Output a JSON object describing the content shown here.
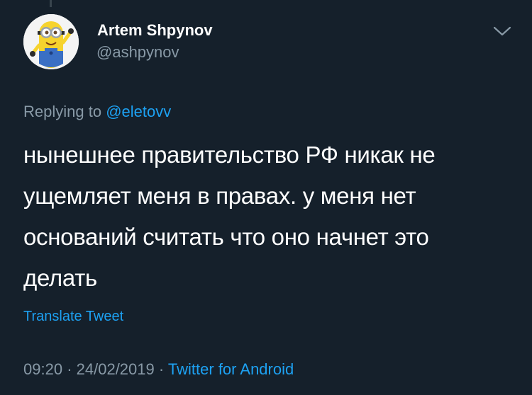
{
  "author": {
    "display_name": "Artem Shpynov",
    "handle": "@ashpynov",
    "avatar_icon": "minion-avatar-icon"
  },
  "reply": {
    "prefix": "Replying to",
    "mention": "@eletovv"
  },
  "tweet": {
    "lines": [
      "нынешнее правительство РФ никак не",
      "ущемляет меня в правах. у меня нет",
      "оснований считать что оно начнет это",
      "делать"
    ],
    "translate_label": "Translate Tweet"
  },
  "meta": {
    "time": "09:20",
    "separator": "·",
    "date": "24/02/2019",
    "source": "Twitter for Android"
  },
  "icons": {
    "more_menu": "chevron-down-icon"
  },
  "colors": {
    "background": "#15202b",
    "link": "#1da1f2",
    "secondary_text": "#8899a6",
    "primary_text": "#ffffff"
  }
}
